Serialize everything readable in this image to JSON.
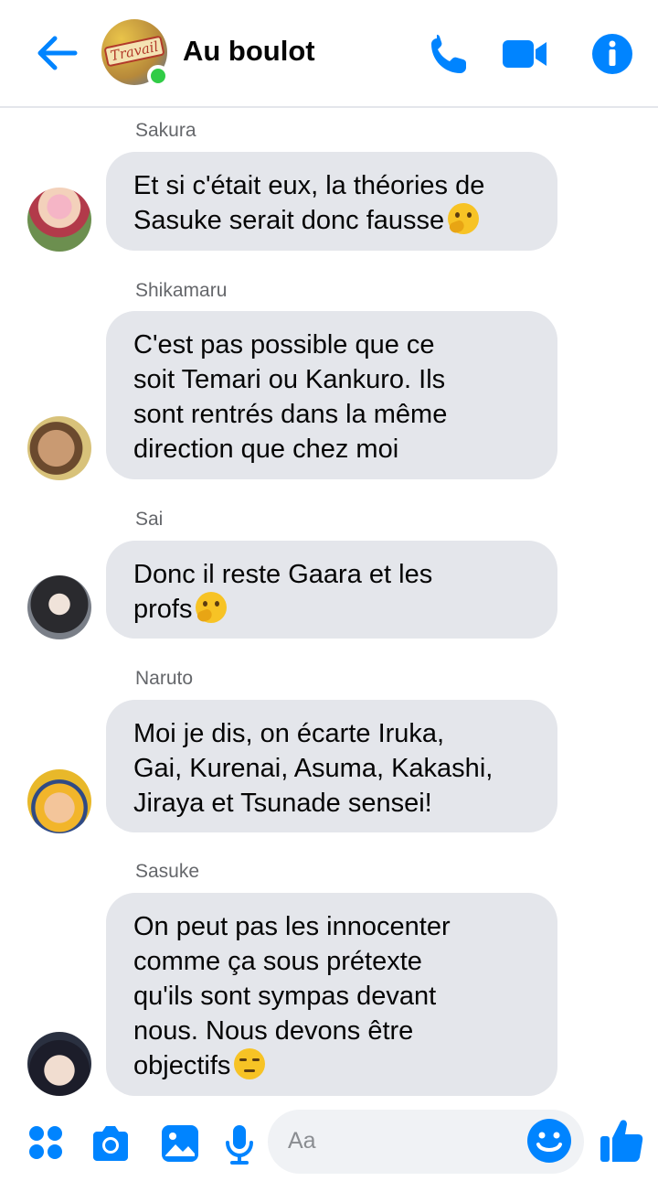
{
  "header": {
    "back_icon": "arrow-left-icon",
    "group_name": "Au boulot",
    "avatar_stamp_text": "Travail",
    "online": true,
    "actions": [
      "phone-icon",
      "video-camera-icon",
      "info-icon"
    ]
  },
  "colors": {
    "accent": "#0084ff",
    "bubble": "#e4e6eb",
    "online": "#31cc46",
    "sender_text": "#65676b"
  },
  "messages": [
    {
      "sender": "Sakura",
      "lines": [
        "Et si c'était eux, la théories de",
        "Sasuke serait donc fausse"
      ],
      "emoji": "thinking-face"
    },
    {
      "sender": "Shikamaru",
      "lines": [
        "C'est pas possible que ce",
        "soit Temari ou Kankuro. Ils",
        "sont rentrés dans la même",
        "direction que chez moi"
      ],
      "emoji": ""
    },
    {
      "sender": "Sai",
      "lines": [
        "Donc il reste Gaara et les",
        "profs"
      ],
      "emoji": "thinking-face"
    },
    {
      "sender": "Naruto",
      "lines": [
        "Moi je dis, on écarte Iruka,",
        "Gai, Kurenai, Asuma, Kakashi,",
        "Jiraya et Tsunade sensei!"
      ],
      "emoji": ""
    },
    {
      "sender": "Sasuke",
      "lines": [
        "On peut pas les innocenter",
        "comme ça sous prétexte",
        "qu'ils sont sympas devant",
        "nous. Nous devons être",
        "objectifs"
      ],
      "emoji": "unamused-face"
    }
  ],
  "composer": {
    "placeholder": "Aa",
    "left_icons": [
      "apps-grid-icon",
      "camera-icon",
      "gallery-icon",
      "microphone-icon"
    ],
    "emoji_icon": "smiley-icon",
    "like_icon": "thumbs-up-icon"
  }
}
